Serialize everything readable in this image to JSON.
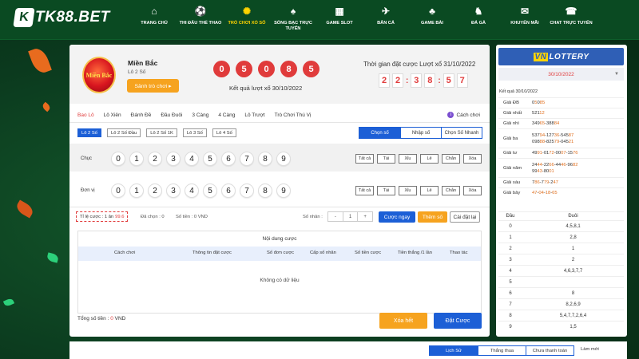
{
  "brand": {
    "mark": "K",
    "name": "TK88.BET"
  },
  "nav": [
    {
      "label": "TRANG CHỦ",
      "icon": "home-icon",
      "glyph": "⌂"
    },
    {
      "label": "THI ĐẤU THỂ THAO",
      "icon": "soccer-ball-icon",
      "glyph": "⚽"
    },
    {
      "label": "TRÒ CHƠI XỔ SỐ",
      "icon": "lottery-icon",
      "glyph": "✺"
    },
    {
      "label": "SÒNG BẠC TRỰC TUYẾN",
      "icon": "casino-chip-icon",
      "glyph": "♠"
    },
    {
      "label": "GAME SLOT",
      "icon": "slot-machine-icon",
      "glyph": "▦"
    },
    {
      "label": "BẮN CÁ",
      "icon": "fish-icon",
      "glyph": "✈"
    },
    {
      "label": "GAME BÀI",
      "icon": "cards-icon",
      "glyph": "♣"
    },
    {
      "label": "ĐÁ GÀ",
      "icon": "rooster-icon",
      "glyph": "♞"
    },
    {
      "label": "KHUYẾN MÃI",
      "icon": "gift-icon",
      "glyph": "✉"
    },
    {
      "label": "CHAT TRỰC TUYẾN",
      "icon": "chat-icon",
      "glyph": "☎"
    }
  ],
  "game": {
    "badge_text": "Miền Bắc",
    "region": "Miền Bắc",
    "type": "Lô 2 Số",
    "rules_button": "Sảnh trò chơi ▸",
    "result_balls": [
      "0",
      "5",
      "0",
      "8",
      "5"
    ],
    "result_label": "Kết quả lượt xổ 30/10/2022",
    "deadline_label": "Thời gian đặt cược Lượt xổ 31/10/2022",
    "timer": [
      "2",
      "2",
      "3",
      "8",
      "5",
      "7"
    ]
  },
  "tabs": [
    "Bao Lô",
    "Lô Xiên",
    "Đánh Đề",
    "Đầu Đuôi",
    "3 Càng",
    "4 Càng",
    "Lô Trượt",
    "Trò Chơi Thú Vị"
  ],
  "guide": {
    "icon_glyph": "i",
    "label": "Cách chơi"
  },
  "subtabs": [
    "Lô 2 Số",
    "Lô 2 Số Đầu",
    "Lô 2 Số 1K",
    "Lô 3 Số",
    "Lô 4 Số"
  ],
  "modes": [
    "Chọn số",
    "Nhập số",
    "Chọn Số Nhanh"
  ],
  "rows": [
    {
      "label": "Chục"
    },
    {
      "label": "Đơn vị"
    }
  ],
  "digits": [
    "0",
    "1",
    "2",
    "3",
    "4",
    "5",
    "6",
    "7",
    "8",
    "9"
  ],
  "quick_buttons": [
    "Tất cả",
    "Tài",
    "Xỉu",
    "Lẻ",
    "Chẵn",
    "Xóa"
  ],
  "bet": {
    "ratio_label": "Tỉ lệ cược : 1 ăn",
    "ratio_value": "99.6",
    "chosen": "Đã chọn : 0",
    "amount": "Số tiền : 0 VND",
    "multiplier_label": "Số nhân :",
    "minus": "-",
    "multiplier_value": "1",
    "plus": "+",
    "bet_now": "Cược ngay",
    "add_number": "Thêm số",
    "reset": "Cài đặt lại"
  },
  "table": {
    "title": "Nội dung cược",
    "headers": [
      "Cách chơi",
      "Thông tin đặt cược",
      "Số đơn cược",
      "Cấp số nhân",
      "Số tiền cược",
      "Tiền thắng /1 lần",
      "Thao tác"
    ],
    "empty": "Không có dữ liệu"
  },
  "total": {
    "label": "Tổng số tiền :",
    "value": "0",
    "unit": "VND"
  },
  "actions": {
    "clear_all": "Xóa hết",
    "place_bet": "Đặt Cược"
  },
  "sidebar": {
    "logo_prefix": "VN",
    "logo_rest": "LOTTERY",
    "date": "30/10/2022",
    "chevron": "▼",
    "result_title": "Kết quả 30/10/2022",
    "results": [
      {
        "prize": "Giải ĐB",
        "lines": [
          [
            [
              "0",
              false
            ],
            [
              "5",
              true
            ],
            [
              "0",
              false
            ],
            [
              "8",
              true
            ],
            [
              "5",
              true
            ]
          ]
        ]
      },
      {
        "prize": "Giải nhất",
        "lines": [
          [
            [
              "521",
              false
            ],
            [
              "12",
              true
            ]
          ]
        ]
      },
      {
        "prize": "Giải nhì",
        "lines": [
          [
            [
              "349",
              false
            ],
            [
              "65",
              true
            ],
            [
              "-388",
              false
            ],
            [
              "84",
              true
            ]
          ]
        ]
      },
      {
        "prize": "Giải ba",
        "lines": [
          [
            [
              "537",
              false
            ],
            [
              "94",
              true
            ],
            [
              "-127",
              false
            ],
            [
              "36",
              true
            ],
            [
              "-545",
              false
            ],
            [
              "87",
              true
            ]
          ],
          [
            [
              "098",
              false
            ],
            [
              "88",
              true
            ],
            [
              "-825",
              false
            ],
            [
              "79",
              true
            ],
            [
              "-045",
              false
            ],
            [
              "21",
              true
            ]
          ]
        ]
      },
      {
        "prize": "Giải tư",
        "lines": [
          [
            [
              "49",
              false
            ],
            [
              "91",
              true
            ],
            [
              "-01",
              false
            ],
            [
              "72",
              true
            ],
            [
              "-00",
              false
            ],
            [
              "07",
              true
            ],
            [
              "-15",
              false
            ],
            [
              "76",
              true
            ]
          ]
        ]
      },
      {
        "prize": "Giải năm",
        "lines": [
          [
            [
              "24",
              false
            ],
            [
              "44",
              true
            ],
            [
              "-22",
              false
            ],
            [
              "66",
              true
            ],
            [
              "-44",
              false
            ],
            [
              "46",
              true
            ],
            [
              "-96",
              false
            ],
            [
              "82",
              true
            ]
          ],
          [
            [
              "99",
              false
            ],
            [
              "43",
              true
            ],
            [
              "-80",
              false
            ],
            [
              "01",
              true
            ]
          ]
        ]
      },
      {
        "prize": "Giải sáu",
        "lines": [
          [
            [
              "7",
              false
            ],
            [
              "86",
              true
            ],
            [
              "-7",
              false
            ],
            [
              "79",
              true
            ],
            [
              "-2",
              false
            ],
            [
              "47",
              true
            ]
          ]
        ]
      },
      {
        "prize": "Giải bảy",
        "lines": [
          [
            [
              "47",
              true
            ],
            [
              "-",
              false
            ],
            [
              "04",
              true
            ],
            [
              "-",
              false
            ],
            [
              "18",
              true
            ],
            [
              "-",
              false
            ],
            [
              "65",
              true
            ]
          ]
        ]
      }
    ],
    "head_tail_header": [
      "Đầu",
      "Đuôi"
    ],
    "head_tail": [
      [
        "0",
        "4,5,8,1"
      ],
      [
        "1",
        "2,8"
      ],
      [
        "2",
        "1"
      ],
      [
        "3",
        "2"
      ],
      [
        "4",
        "4,6,3,7,7"
      ],
      [
        "5",
        ""
      ],
      [
        "6",
        "8"
      ],
      [
        "7",
        "8,2,6,9"
      ],
      [
        "8",
        "5,4,7,7,2,6,4"
      ],
      [
        "9",
        "1,5"
      ]
    ]
  },
  "bottom_tabs": [
    "Lịch Sử",
    "Thắng thua",
    "Chưa thanh toán"
  ],
  "refresh": "Làm mới",
  "colors": {
    "accent_blue": "#1c5fd6",
    "brand_green": "#0a4a22",
    "ball_red": "#e03b3b",
    "orange": "#f6a31f",
    "highlight_yellow": "#ffd400"
  }
}
